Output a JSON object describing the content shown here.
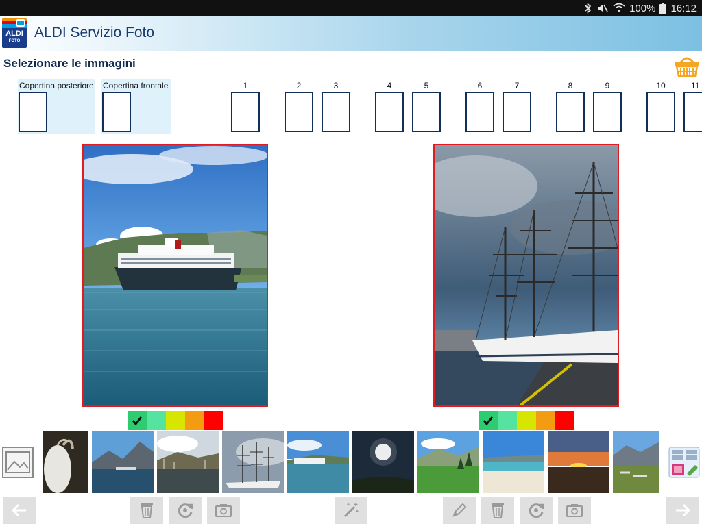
{
  "status_bar": {
    "battery": "100%",
    "time": "16:12",
    "icons": [
      "bluetooth-icon",
      "mute-icon",
      "wifi-icon",
      "battery-icon"
    ]
  },
  "app": {
    "logo_text": "ALDI",
    "logo_subtext": "FOTO",
    "title": "ALDI Servizio Foto"
  },
  "page": {
    "title": "Selezionare le immagini"
  },
  "page_strip": {
    "back_cover_label": "Copertina posteriore",
    "front_cover_label": "Copertina frontale",
    "page_numbers": [
      "1",
      "2",
      "3",
      "4",
      "5",
      "6",
      "7",
      "8",
      "9",
      "10",
      "11"
    ]
  },
  "spread": {
    "left_photo": "cruise-ship-fjord",
    "right_photo": "tall-ship-harbor",
    "quality_colors": [
      "#2ecc71",
      "#56e39f",
      "#d7e600",
      "#f39c12",
      "#ff0000"
    ],
    "left_quality_selected": 0,
    "right_quality_selected": 0
  },
  "thumbnails": [
    "goat",
    "harbor-mountains",
    "marina-town",
    "tall-ship",
    "cruise-ship",
    "sun-sky",
    "alpine-meadow",
    "beach",
    "sunset",
    "mountain-town"
  ],
  "toolbar": {
    "icons": [
      "back-arrow-icon",
      "trash-icon",
      "rotate-icon",
      "camera-icon",
      "magic-wand-icon",
      "pencil-icon",
      "trash-icon",
      "rotate-icon",
      "camera-icon",
      "forward-arrow-icon"
    ]
  },
  "colors": {
    "accent": "#1a3c6e",
    "selection_border": "#e21b23",
    "cart": "#f5a623"
  }
}
